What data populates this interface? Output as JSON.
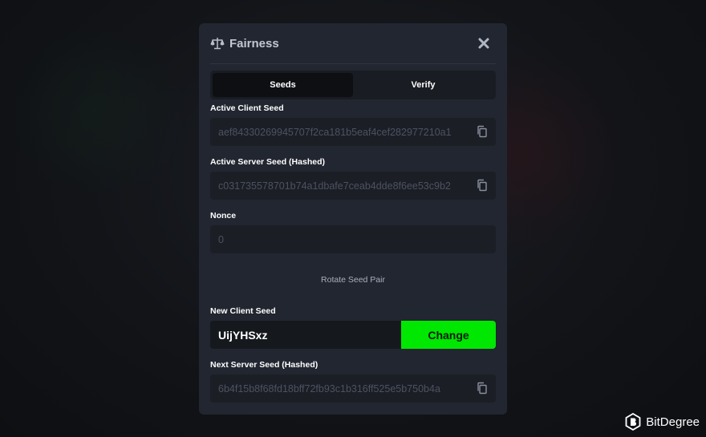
{
  "modal": {
    "title": "Fairness",
    "header_icon": "scale-icon",
    "close_icon": "close-icon"
  },
  "tabs": [
    {
      "label": "Seeds",
      "active": true
    },
    {
      "label": "Verify",
      "active": false
    }
  ],
  "seeds": {
    "active_client_label": "Active Client Seed",
    "active_client_value": "aef84330269945707f2ca181b5eaf4cef282977210a1",
    "active_server_label": "Active Server Seed (Hashed)",
    "active_server_value": "c031735578701b74a1dbafe7ceab4dde8f6ee53c9b2",
    "nonce_label": "Nonce",
    "nonce_value": "0",
    "rotate_label": "Rotate Seed Pair",
    "new_client_label": "New Client Seed",
    "new_client_value": "UijYHSxz",
    "change_label": "Change",
    "next_server_label": "Next Server Seed (Hashed)",
    "next_server_value": "6b4f15b8f68fd18bff72fb93c1b316ff525e5b750b4a",
    "copy_icon": "copy-icon"
  },
  "colors": {
    "accent": "#00e701",
    "modal_bg": "#222630",
    "field_bg": "#1b1e25"
  },
  "watermark": {
    "text": "BitDegree"
  }
}
